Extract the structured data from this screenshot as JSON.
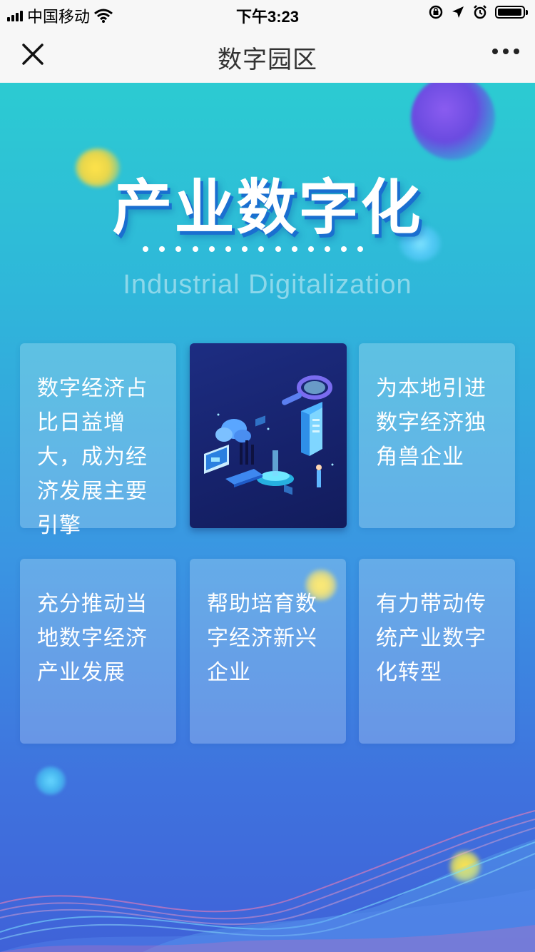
{
  "status_bar": {
    "carrier": "中国移动",
    "time": "下午3:23",
    "battery_level": 0.9
  },
  "nav": {
    "title": "数字园区"
  },
  "banner": {
    "headline": "产业数字化",
    "subheading": "Industrial Digitalization"
  },
  "cards": [
    {
      "text": "数字经济占比日益增大，成为经济发展主要引擎"
    },
    {
      "text": "为本地引进数字经济独角兽企业"
    },
    {
      "text": "充分推动当地数字经济产业发展"
    },
    {
      "text": "帮助培育数字经济新兴企业"
    },
    {
      "text": "有力带动传统产业数字化转型"
    }
  ],
  "colors": {
    "gradient_top": "#2ccbd2",
    "gradient_bottom": "#3f62d8",
    "headline_shadow": "#1a6fd0",
    "image_card_bg": "#16226b"
  },
  "icons": [
    "signal-icon",
    "wifi-icon",
    "lock-rotation-icon",
    "location-icon",
    "alarm-icon",
    "battery-icon",
    "close-icon",
    "more-icon"
  ]
}
